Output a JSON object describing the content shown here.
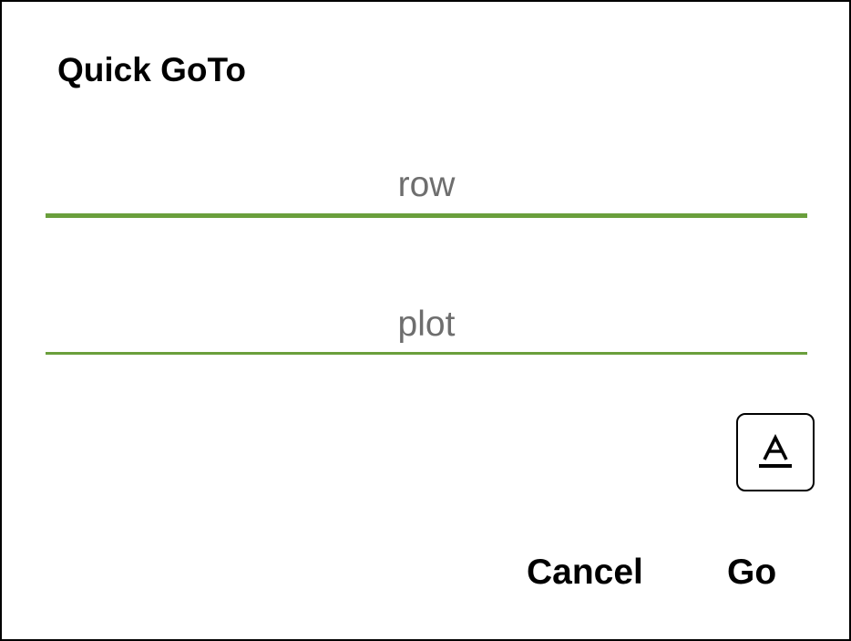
{
  "dialog": {
    "title": "Quick GoTo",
    "fields": {
      "row": {
        "value": "",
        "placeholder": "row",
        "active": true
      },
      "plot": {
        "value": "",
        "placeholder": "plot",
        "active": false
      }
    },
    "font_toggle": {
      "icon": "text-format-icon",
      "glyph": "A"
    },
    "actions": {
      "cancel_label": "Cancel",
      "go_label": "Go"
    }
  },
  "colors": {
    "accent_underline": "#6a9f3c",
    "text": "#000000",
    "placeholder": "#6e6e6e",
    "border": "#000000",
    "background": "#ffffff"
  }
}
